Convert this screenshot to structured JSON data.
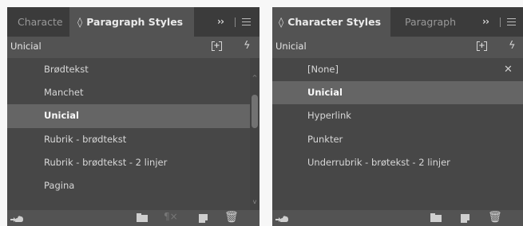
{
  "left_panel": {
    "tab_inactive": "Characte",
    "tab_active": "Paragraph Styles",
    "tab_active_glyph": "◊",
    "overflow_glyph": "››",
    "header_label": "Unicial",
    "header_new_group_glyph": "+",
    "header_lightning_glyph": "ϟ",
    "items": [
      {
        "label": "Brødtekst"
      },
      {
        "label": "Manchet"
      },
      {
        "label": "Unicial"
      },
      {
        "label": "Rubrik - brødtekst"
      },
      {
        "label": "Rubrik - brødtekst - 2 linjer"
      },
      {
        "label": "Pagina"
      }
    ],
    "selected_index": 2,
    "scroll_up_glyph": "^",
    "scroll_down_glyph": "v",
    "footer_para_glyph": "¶×",
    "footer_trash_glyph": "🗑"
  },
  "right_panel": {
    "tab_active": "Character Styles",
    "tab_active_glyph": "◊",
    "tab_inactive": "Paragraph",
    "overflow_glyph": "››",
    "header_label": "Unicial",
    "header_new_group_glyph": "+",
    "header_lightning_glyph": "ϟ",
    "items": [
      {
        "label": "[None]"
      },
      {
        "label": "Unicial"
      },
      {
        "label": "Hyperlink"
      },
      {
        "label": "Punkter"
      },
      {
        "label": "Underrubrik - brøtekst - 2 linjer"
      }
    ],
    "selected_index": 1,
    "none_icon_glyph": "✕",
    "footer_trash_glyph": "🗑"
  },
  "colors": {
    "panel_bg": "#535353",
    "tabbar_bg": "#3b3b3b",
    "list_bg": "#474747",
    "selected_row_bg": "#656565"
  }
}
